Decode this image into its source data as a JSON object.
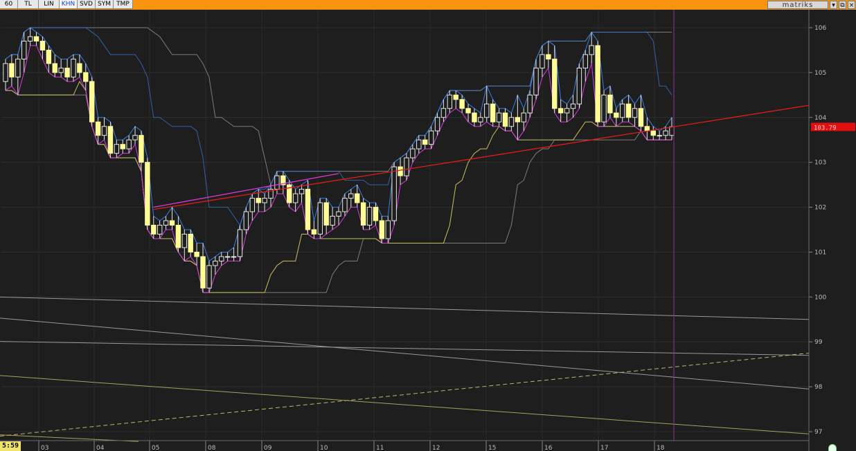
{
  "toolbar": {
    "buttons": [
      "60",
      "TL",
      "LIN",
      "KHN",
      "SVD",
      "SYM",
      "TMP"
    ],
    "active": "KHN",
    "brand": "matriks",
    "background": "#f7930f"
  },
  "time_label": "5:59",
  "colors": {
    "background": "#1e1e1e",
    "candle_up": "#fffb96",
    "candle_down": "#fffb96",
    "envelope_upper": "#3a7fe0",
    "envelope_lower": "#d93adc",
    "trend_line": "#e01c1c",
    "price_badge": "#e01010",
    "cursor_line": "#9b2f9b",
    "axis_text": "#bdbdbd",
    "yellow_line": "#c8c060",
    "channel_line": "#7c7c7c"
  },
  "chart_data": {
    "type": "candlestick",
    "title": "",
    "xlabel": "",
    "ylabel": "",
    "ylim": [
      96.8,
      106.4
    ],
    "yticks": [
      97,
      98,
      99,
      100,
      101,
      102,
      103,
      104,
      105,
      106
    ],
    "xticks": [
      "03",
      "04",
      "05",
      "08",
      "09",
      "10",
      "11",
      "12",
      "15",
      "16",
      "17",
      "18"
    ],
    "grid": true,
    "last_price": "103.79",
    "candles": [
      [
        104.8,
        105.3,
        104.6,
        105.2
      ],
      [
        105.2,
        105.4,
        104.7,
        104.9
      ],
      [
        104.9,
        105.4,
        104.5,
        105.3
      ],
      [
        105.3,
        105.9,
        105.0,
        105.7
      ],
      [
        105.7,
        106.0,
        105.6,
        105.8
      ],
      [
        105.8,
        105.9,
        105.6,
        105.7
      ],
      [
        105.7,
        105.8,
        105.3,
        105.5
      ],
      [
        105.5,
        105.6,
        105.0,
        105.2
      ],
      [
        105.2,
        105.4,
        104.9,
        105.0
      ],
      [
        105.0,
        105.3,
        104.9,
        105.1
      ],
      [
        105.1,
        105.3,
        104.8,
        104.9
      ],
      [
        104.9,
        105.4,
        104.8,
        105.3
      ],
      [
        105.2,
        105.4,
        104.9,
        105.0
      ],
      [
        105.0,
        105.2,
        104.6,
        104.8
      ],
      [
        104.8,
        104.9,
        103.8,
        103.9
      ],
      [
        103.9,
        104.0,
        103.4,
        103.6
      ],
      [
        103.6,
        104.0,
        103.5,
        103.8
      ],
      [
        103.8,
        103.9,
        103.1,
        103.2
      ],
      [
        103.2,
        103.5,
        103.1,
        103.4
      ],
      [
        103.4,
        103.5,
        103.2,
        103.3
      ],
      [
        103.3,
        103.6,
        103.2,
        103.5
      ],
      [
        103.5,
        103.8,
        103.4,
        103.6
      ],
      [
        103.6,
        103.7,
        102.8,
        103.0
      ],
      [
        103.0,
        103.1,
        101.5,
        101.6
      ],
      [
        101.6,
        101.8,
        101.3,
        101.4
      ],
      [
        101.4,
        101.7,
        101.3,
        101.6
      ],
      [
        101.6,
        101.8,
        101.5,
        101.7
      ],
      [
        101.7,
        102.0,
        101.5,
        101.6
      ],
      [
        101.6,
        101.8,
        101.0,
        101.1
      ],
      [
        101.1,
        101.5,
        100.8,
        101.4
      ],
      [
        101.4,
        101.5,
        100.9,
        101.0
      ],
      [
        101.0,
        101.2,
        100.7,
        100.9
      ],
      [
        100.9,
        101.2,
        100.1,
        100.2
      ],
      [
        100.2,
        100.8,
        100.1,
        100.7
      ],
      [
        100.7,
        100.9,
        100.5,
        100.8
      ],
      [
        100.8,
        101.0,
        100.7,
        100.9
      ],
      [
        100.9,
        101.0,
        100.8,
        100.9
      ],
      [
        100.9,
        101.1,
        100.8,
        100.9
      ],
      [
        100.9,
        101.6,
        100.8,
        101.5
      ],
      [
        101.5,
        102.0,
        101.4,
        101.9
      ],
      [
        101.9,
        102.3,
        101.7,
        102.2
      ],
      [
        102.2,
        102.4,
        101.9,
        102.1
      ],
      [
        102.1,
        102.3,
        101.9,
        102.2
      ],
      [
        102.2,
        102.5,
        102.0,
        102.4
      ],
      [
        102.4,
        102.8,
        102.3,
        102.7
      ],
      [
        102.7,
        102.8,
        102.3,
        102.5
      ],
      [
        102.5,
        102.6,
        102.0,
        102.1
      ],
      [
        102.1,
        102.4,
        101.9,
        102.3
      ],
      [
        102.3,
        102.5,
        102.1,
        102.4
      ],
      [
        102.4,
        102.6,
        101.4,
        101.5
      ],
      [
        101.5,
        101.7,
        101.3,
        101.4
      ],
      [
        101.4,
        102.2,
        101.3,
        102.1
      ],
      [
        102.1,
        102.2,
        101.4,
        101.6
      ],
      [
        101.6,
        102.0,
        101.5,
        101.8
      ],
      [
        101.8,
        102.0,
        101.6,
        101.9
      ],
      [
        101.9,
        102.3,
        101.8,
        102.2
      ],
      [
        102.2,
        102.4,
        102.0,
        102.3
      ],
      [
        102.3,
        102.5,
        102.0,
        102.1
      ],
      [
        102.1,
        102.2,
        101.5,
        101.6
      ],
      [
        101.6,
        102.1,
        101.5,
        102.0
      ],
      [
        102.0,
        102.1,
        101.6,
        101.7
      ],
      [
        101.7,
        101.8,
        101.2,
        101.3
      ],
      [
        101.3,
        101.8,
        101.2,
        101.7
      ],
      [
        101.7,
        103.0,
        101.6,
        102.9
      ],
      [
        102.9,
        103.1,
        102.5,
        102.7
      ],
      [
        102.7,
        103.2,
        102.6,
        103.1
      ],
      [
        103.1,
        103.4,
        103.0,
        103.3
      ],
      [
        103.3,
        103.6,
        103.2,
        103.5
      ],
      [
        103.5,
        103.6,
        103.3,
        103.4
      ],
      [
        103.4,
        103.8,
        103.3,
        103.7
      ],
      [
        103.7,
        104.1,
        103.6,
        104.0
      ],
      [
        104.0,
        104.4,
        103.9,
        104.2
      ],
      [
        104.2,
        104.6,
        104.1,
        104.5
      ],
      [
        104.5,
        104.6,
        104.2,
        104.4
      ],
      [
        104.4,
        104.5,
        104.1,
        104.2
      ],
      [
        104.2,
        104.3,
        103.9,
        104.1
      ],
      [
        104.1,
        104.2,
        103.8,
        103.9
      ],
      [
        103.9,
        104.1,
        103.8,
        104.0
      ],
      [
        104.0,
        104.7,
        103.9,
        104.3
      ],
      [
        104.3,
        104.4,
        103.8,
        103.9
      ],
      [
        103.9,
        104.2,
        103.8,
        104.1
      ],
      [
        104.1,
        104.2,
        103.7,
        103.8
      ],
      [
        103.8,
        104.1,
        103.7,
        104.0
      ],
      [
        104.0,
        104.5,
        103.5,
        103.9
      ],
      [
        103.9,
        104.2,
        103.7,
        104.1
      ],
      [
        104.1,
        104.6,
        104.0,
        104.5
      ],
      [
        104.5,
        105.3,
        104.4,
        105.1
      ],
      [
        105.1,
        105.6,
        104.9,
        105.4
      ],
      [
        105.4,
        105.7,
        105.1,
        105.3
      ],
      [
        105.3,
        105.6,
        104.1,
        104.2
      ],
      [
        104.2,
        104.4,
        103.9,
        104.1
      ],
      [
        104.1,
        104.3,
        103.9,
        104.2
      ],
      [
        104.2,
        104.5,
        104.0,
        104.3
      ],
      [
        104.3,
        105.2,
        104.2,
        105.1
      ],
      [
        105.1,
        105.5,
        104.8,
        105.4
      ],
      [
        105.4,
        105.9,
        105.2,
        105.6
      ],
      [
        105.6,
        105.7,
        103.8,
        103.9
      ],
      [
        103.9,
        104.6,
        103.8,
        104.5
      ],
      [
        104.5,
        104.7,
        104.0,
        104.1
      ],
      [
        104.1,
        104.2,
        103.8,
        104.0
      ],
      [
        104.0,
        104.4,
        103.9,
        104.3
      ],
      [
        104.3,
        104.5,
        103.9,
        104.0
      ],
      [
        104.0,
        104.3,
        103.8,
        104.2
      ],
      [
        104.2,
        104.5,
        103.7,
        103.8
      ],
      [
        103.8,
        104.0,
        103.5,
        103.7
      ],
      [
        103.7,
        103.8,
        103.5,
        103.6
      ],
      [
        103.6,
        103.7,
        103.5,
        103.6
      ],
      [
        103.6,
        103.8,
        103.5,
        103.7
      ],
      [
        103.6,
        104.0,
        103.5,
        103.79
      ]
    ]
  }
}
